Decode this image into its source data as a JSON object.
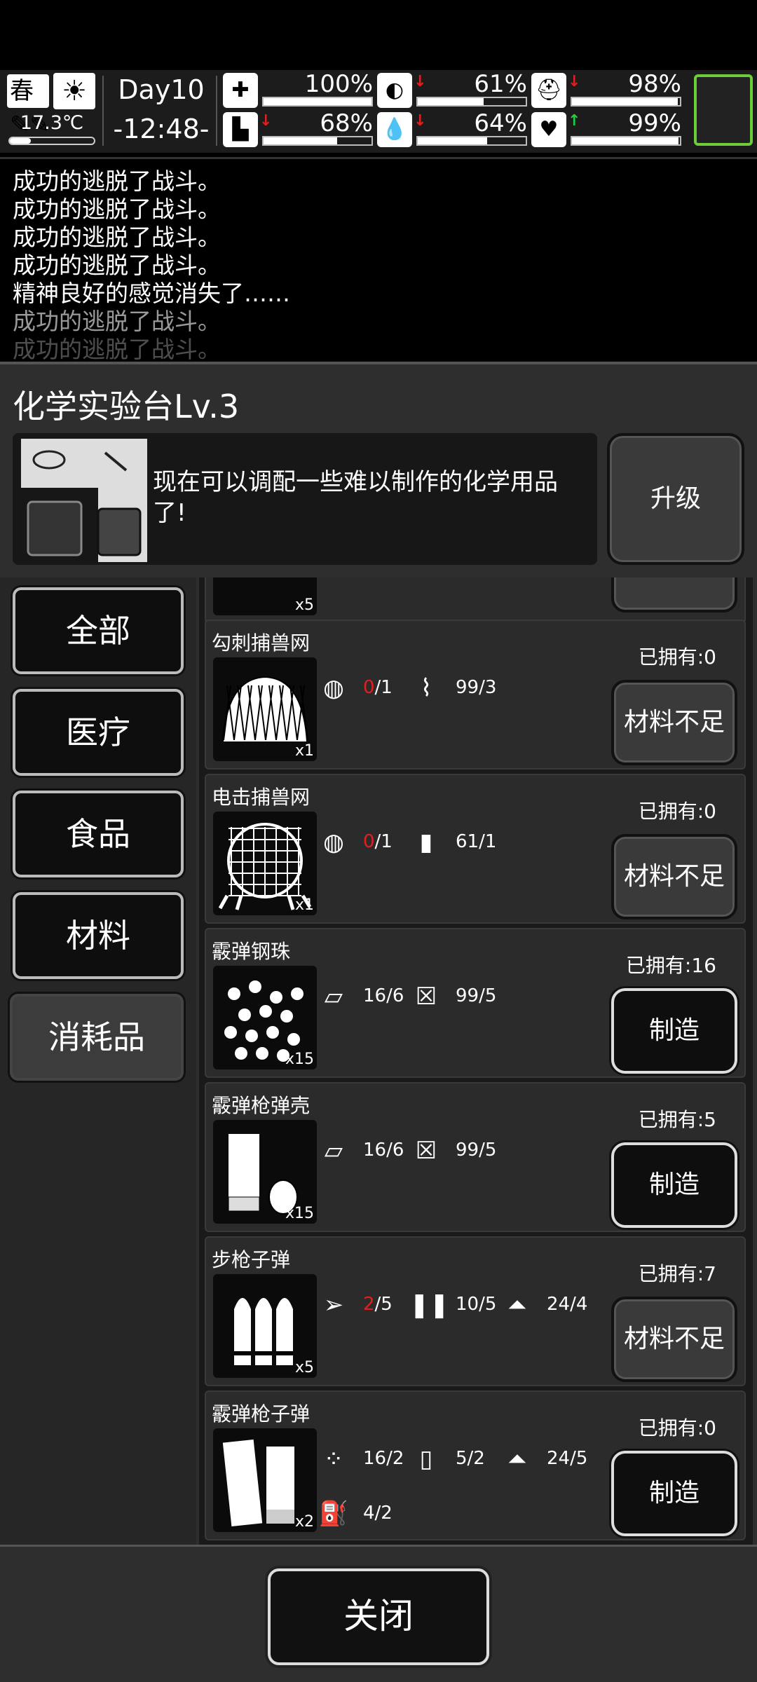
{
  "status": {
    "season": "春",
    "temperature": "17.3℃",
    "day": "Day10",
    "time": "-12:48-",
    "stats": [
      {
        "icon": "medical-kit-icon",
        "value": "100%",
        "level": 1.0,
        "trend": ""
      },
      {
        "icon": "stomach-icon",
        "value": "61%",
        "level": 0.61,
        "trend": "down"
      },
      {
        "icon": "helmet-icon",
        "value": "98%",
        "level": 0.98,
        "trend": "down"
      },
      {
        "icon": "boot-icon",
        "value": "68%",
        "level": 0.68,
        "trend": "down"
      },
      {
        "icon": "water-drop-icon",
        "value": "64%",
        "level": 0.64,
        "trend": "down"
      },
      {
        "icon": "heart-icon",
        "value": "99%",
        "level": 0.99,
        "trend": "up"
      }
    ]
  },
  "log": [
    "成功的逃脱了战斗。",
    "成功的逃脱了战斗。",
    "成功的逃脱了战斗。",
    "成功的逃脱了战斗。",
    "精神良好的感觉消失了……",
    "成功的逃脱了战斗。",
    "成功的逃脱了战斗。"
  ],
  "panel": {
    "title": "化学实验台Lv.3",
    "description": "现在可以调配一些难以制作的化学用品了!",
    "upgrade_label": "升级",
    "close_label": "关闭"
  },
  "categories": [
    "全部",
    "医疗",
    "食品",
    "材料",
    "消耗品"
  ],
  "partial_item_qty": "x5",
  "recipes": [
    {
      "name": "勾刺捕兽网",
      "qty": "x1",
      "owned": "已拥有:0",
      "button": "材料不足",
      "button_type": "lack",
      "materials": [
        {
          "icon": "net-icon",
          "have": "0",
          "need": "/1",
          "short": true
        },
        {
          "icon": "wire-icon",
          "have": "99/3",
          "need": "",
          "short": false
        }
      ]
    },
    {
      "name": "电击捕兽网",
      "qty": "x1",
      "owned": "已拥有:0",
      "button": "材料不足",
      "button_type": "lack",
      "materials": [
        {
          "icon": "net-icon",
          "have": "0",
          "need": "/1",
          "short": true
        },
        {
          "icon": "battery-icon",
          "have": "61/1",
          "need": "",
          "short": false
        }
      ]
    },
    {
      "name": "霰弹钢珠",
      "qty": "x15",
      "owned": "已拥有:16",
      "button": "制造",
      "button_type": "make",
      "materials": [
        {
          "icon": "metal-plate-icon",
          "have": "16/6",
          "need": "",
          "short": false
        },
        {
          "icon": "chemical-can-icon",
          "have": "99/5",
          "need": "",
          "short": false
        }
      ]
    },
    {
      "name": "霰弹枪弹壳",
      "qty": "x15",
      "owned": "已拥有:5",
      "button": "制造",
      "button_type": "make",
      "materials": [
        {
          "icon": "metal-plate-icon",
          "have": "16/6",
          "need": "",
          "short": false
        },
        {
          "icon": "chemical-can-icon",
          "have": "99/5",
          "need": "",
          "short": false
        }
      ]
    },
    {
      "name": "步枪子弹",
      "qty": "x5",
      "owned": "已拥有:7",
      "button": "材料不足",
      "button_type": "lack",
      "materials": [
        {
          "icon": "bullet-head-icon",
          "have": "2",
          "need": "/5",
          "short": true
        },
        {
          "icon": "casing-icon",
          "have": "10/5",
          "need": "",
          "short": false
        },
        {
          "icon": "gunpowder-icon",
          "have": "24/4",
          "need": "",
          "short": false
        }
      ]
    },
    {
      "name": "霰弹枪子弹",
      "qty": "x2",
      "owned": "已拥有:0",
      "button": "制造",
      "button_type": "make",
      "materials": [
        {
          "icon": "pellets-icon",
          "have": "16/2",
          "need": "",
          "short": false
        },
        {
          "icon": "shell-casing-icon",
          "have": "5/2",
          "need": "",
          "short": false
        },
        {
          "icon": "gunpowder-icon",
          "have": "24/5",
          "need": "",
          "short": false
        },
        {
          "icon": "fuel-can-icon",
          "have": "4/2",
          "need": "",
          "short": false
        }
      ]
    }
  ]
}
